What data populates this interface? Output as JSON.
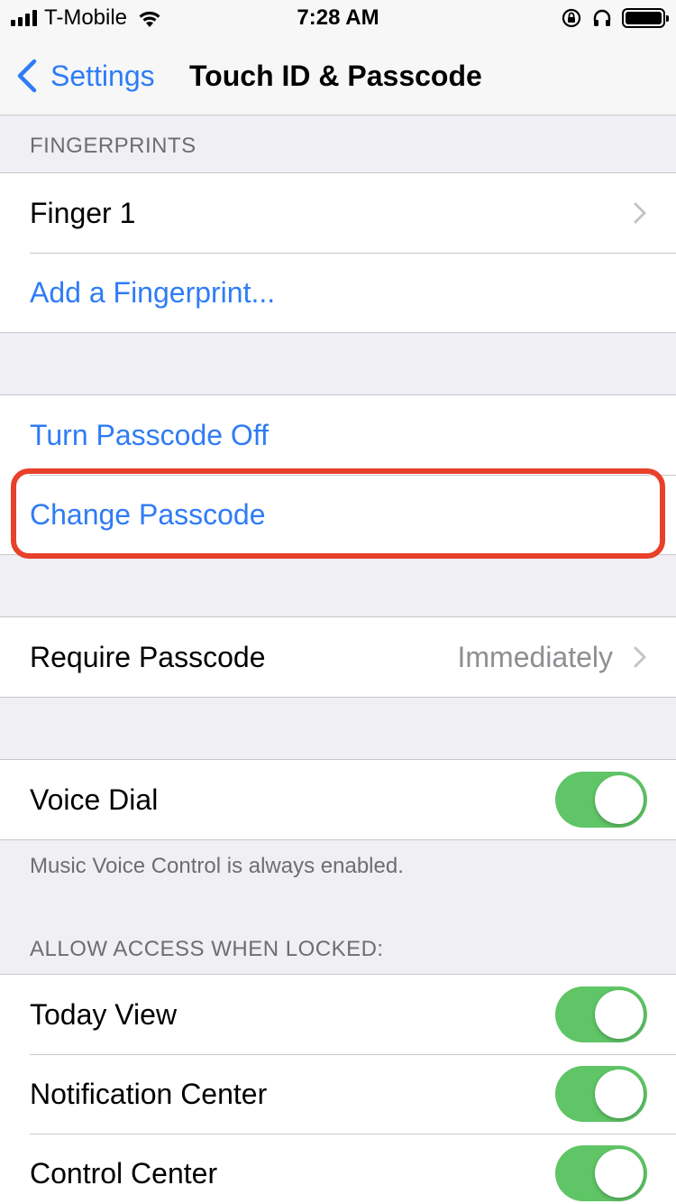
{
  "status": {
    "carrier": "T-Mobile",
    "time": "7:28 AM"
  },
  "nav": {
    "back_label": "Settings",
    "title": "Touch ID & Passcode"
  },
  "fingerprints": {
    "header": "FINGERPRINTS",
    "finger_label": "Finger 1",
    "add_label": "Add a Fingerprint..."
  },
  "passcode": {
    "turn_off_label": "Turn Passcode Off",
    "change_label": "Change Passcode"
  },
  "require": {
    "label": "Require Passcode",
    "value": "Immediately"
  },
  "voice_dial": {
    "label": "Voice Dial",
    "enabled": true,
    "note": "Music Voice Control is always enabled."
  },
  "locked_access": {
    "header": "ALLOW ACCESS WHEN LOCKED:",
    "items": [
      {
        "label": "Today View",
        "enabled": true
      },
      {
        "label": "Notification Center",
        "enabled": true
      },
      {
        "label": "Control Center",
        "enabled": true
      }
    ]
  },
  "colors": {
    "accent": "#2f7cf6",
    "toggle_on": "#5fc566",
    "highlight": "#e8402a"
  }
}
